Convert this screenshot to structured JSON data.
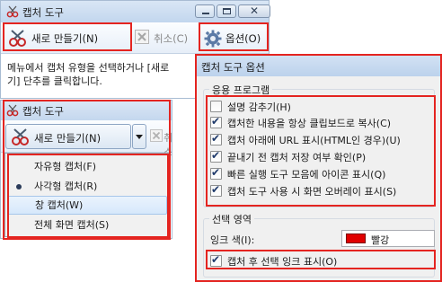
{
  "window1": {
    "title": "캡처 도구",
    "toolbar": {
      "new_label": "새로 만들기(N)",
      "cancel_label": "취소(C)",
      "options_label": "옵션(O)"
    },
    "body_lines": [
      "메뉴에서 캡처 유형을 선택하거나 [새로",
      "기] 단추를 클릭합니다."
    ]
  },
  "window2": {
    "title": "캡처 도구",
    "toolbar": {
      "new_label": "새로 만들기(N)",
      "cancel_partial": "취소"
    },
    "menu_items": [
      {
        "label": "자유형 캡처(F)",
        "selected": false,
        "hover": false
      },
      {
        "label": "사각형 캡처(R)",
        "selected": true,
        "hover": false
      },
      {
        "label": "창 캡처(W)",
        "selected": false,
        "hover": true
      },
      {
        "label": "전체 화면 캡처(S)",
        "selected": false,
        "hover": false
      }
    ]
  },
  "dialog": {
    "title": "캡처 도구 옵션",
    "app_group": {
      "legend": "응용 프로그램",
      "options": [
        {
          "label": "설명 감추기(H)",
          "checked": false
        },
        {
          "label": "캡처한 내용을 항상 클립보드로 복사(C)",
          "checked": true
        },
        {
          "label": "캡처 아래에 URL 표시(HTML인 경우)(U)",
          "checked": true
        },
        {
          "label": "끝내기 전 캡처 저장 여부 확인(P)",
          "checked": true
        },
        {
          "label": "빠른 실행 도구 모음에 아이콘 표시(Q)",
          "checked": true
        },
        {
          "label": "캡처 도구 사용 시 화면 오버레이 표시(S)",
          "checked": true
        }
      ]
    },
    "selection_group": {
      "legend": "선택 영역",
      "ink_color_label": "잉크 색(I):",
      "ink_color_value": "빨강",
      "ink_color_hex": "#e00000",
      "show_ink_label": "캡처 후 선택 잉크 표시(O)",
      "show_ink_checked": true
    }
  },
  "colors": {
    "annotation_red": "#e42420",
    "titlebar_blue": "#c2d6ee"
  },
  "icons": [
    "scissors-icon",
    "cancel-x-icon",
    "gear-icon",
    "dropdown-arrow-icon",
    "minimize-icon",
    "maximize-icon",
    "close-icon"
  ]
}
